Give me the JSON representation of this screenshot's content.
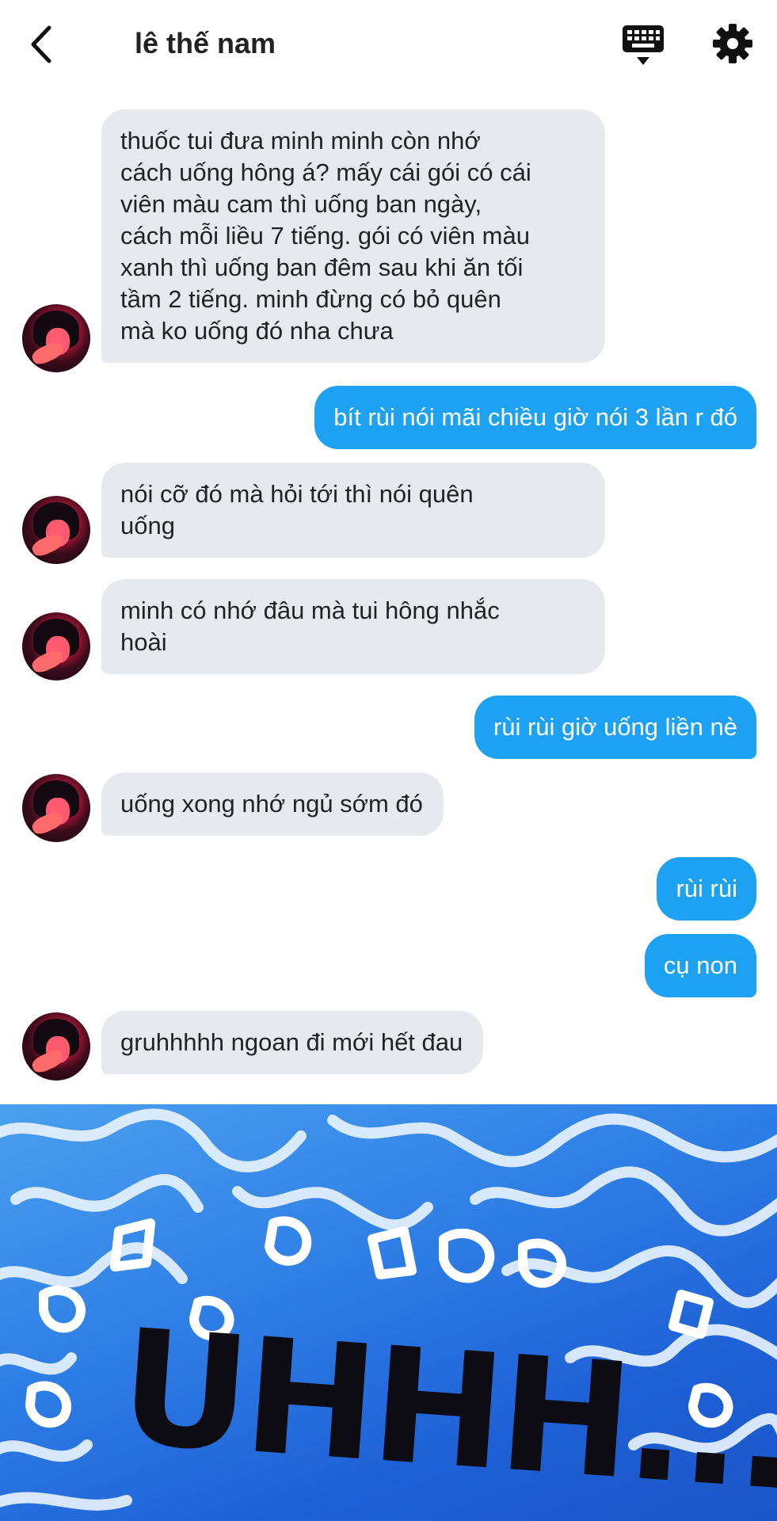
{
  "header": {
    "title": "lê thế nam",
    "back_icon": "chevron-left-icon",
    "keyboard_icon": "keyboard-icon",
    "settings_icon": "gear-icon"
  },
  "messages": [
    {
      "direction": "in",
      "text": "thuốc tui đưa minh minh còn nhớ\ncách uống hông á? mấy cái gói có cái\nviên màu cam thì uống ban ngày,\ncách mỗi liều 7 tiếng. gói có viên màu\nxanh thì uống ban đêm sau khi ăn tối\ntầm 2 tiếng. minh đừng có bỏ quên\nmà ko uống đó nha chưa"
    },
    {
      "direction": "out",
      "text": "bít rùi nói mãi chiều giờ nói 3 lần r đó"
    },
    {
      "direction": "in",
      "text": "nói cỡ đó mà hỏi tới thì nói quên\nuống"
    },
    {
      "direction": "in",
      "text": "minh có nhớ đâu mà tui hông nhắc\nhoài"
    },
    {
      "direction": "out",
      "text": "rùi rùi giờ uống liền nè"
    },
    {
      "direction": "in",
      "text": "uống xong nhớ ngủ sớm đó"
    },
    {
      "direction": "out",
      "text": "rùi rùi"
    },
    {
      "direction": "out",
      "text": "cụ non"
    },
    {
      "direction": "in",
      "text": "gruhhhhh ngoan đi mới hết đau"
    }
  ],
  "sticker": {
    "text": "UHHH..."
  },
  "colors": {
    "outgoing_bubble": "#1da1f2",
    "incoming_bubble": "#e6eaee"
  }
}
